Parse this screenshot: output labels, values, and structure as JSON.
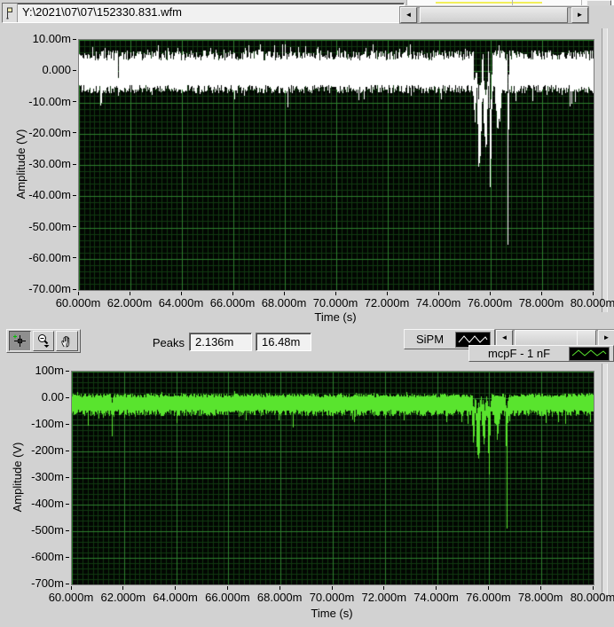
{
  "icons": {
    "left_arrow": "◄",
    "right_arrow": "►"
  },
  "path_bar": {
    "value": "Y:\\2021\\07\\07\\152330.831.wfm"
  },
  "toolbar": {
    "peaks_label": "Peaks",
    "peak_values": [
      "2.136m",
      "16.48m"
    ]
  },
  "legends": {
    "sipm": {
      "label": "SiPM",
      "color": "#ffffff"
    },
    "mcp": {
      "label": "mcpF - 1 nF",
      "color": "#59e42e"
    }
  },
  "clipped_top": {
    "line_color": "#f2ef5a"
  },
  "chart_data": [
    {
      "type": "line",
      "series_name": "SiPM",
      "color": "#ffffff",
      "bg": "#020602",
      "grid": {
        "major": "#2e7f2e",
        "minor": "#113a11"
      },
      "xlabel": "Time (s)",
      "ylabel": "Amplitude (V)",
      "x_range_ms": [
        60,
        80
      ],
      "y_range_mv": [
        -70,
        10
      ],
      "x_major_ms": 2,
      "x_minor_ms": 0.2,
      "y_major_mv": 10,
      "y_minor_mv": 2,
      "x_ticks": [
        "60.000m",
        "62.000m",
        "64.000m",
        "66.000m",
        "68.000m",
        "70.000m",
        "72.000m",
        "74.000m",
        "76.000m",
        "78.000m",
        "80.000m"
      ],
      "y_ticks": [
        "10.00m",
        "0.000",
        "-10.00m",
        "-20.00m",
        "-30.00m",
        "-40.00m",
        "-50.00m",
        "-60.00m",
        "-70.00m"
      ],
      "noise": {
        "band_high": 6.5,
        "jitter_high": 3.2,
        "band_low": -4.2,
        "jitter_low": 2.8,
        "up_prob": 0.18,
        "up_extra": 2.5,
        "spike_prob": 0.07,
        "spike_extra": 5
      },
      "events": [
        {
          "t": 61.55,
          "w": 0.05,
          "depth": -12.5
        },
        {
          "t": 75.4,
          "w": 0.1,
          "depth": -20
        },
        {
          "t": 75.58,
          "w": 0.16,
          "depth": -42
        },
        {
          "t": 75.8,
          "w": 0.14,
          "depth": -35
        },
        {
          "t": 76.0,
          "w": 0.1,
          "depth": -41
        },
        {
          "t": 76.3,
          "w": 0.26,
          "depth": -20,
          "partial": true
        },
        {
          "t": 76.68,
          "w": 0.05,
          "depth": -70
        }
      ],
      "seed": 3
    },
    {
      "type": "line",
      "series_name": "mcpF - 1 nF",
      "color": "#59e42e",
      "bg": "#020602",
      "grid": {
        "major": "#2e7f2e",
        "minor": "#113a11"
      },
      "xlabel": "Time (s)",
      "ylabel": "Amplitude (V)",
      "x_range_ms": [
        60,
        80
      ],
      "y_range_mv": [
        -700,
        100
      ],
      "x_major_ms": 2,
      "x_minor_ms": 0.2,
      "y_major_mv": 100,
      "y_minor_mv": 20,
      "x_ticks": [
        "60.000m",
        "62.000m",
        "64.000m",
        "66.000m",
        "68.000m",
        "70.000m",
        "72.000m",
        "74.000m",
        "76.000m",
        "78.000m",
        "80.000m"
      ],
      "y_ticks": [
        "100m",
        "0.00",
        "-100m",
        "-200m",
        "-300m",
        "-400m",
        "-500m",
        "-600m",
        "-700m"
      ],
      "noise": {
        "band_high": 16,
        "jitter_high": 14,
        "band_low": -42,
        "jitter_low": 25,
        "up_prob": 0.18,
        "up_extra": 8,
        "spike_prob": 0.05,
        "spike_extra": 45
      },
      "events": [
        {
          "t": 61.55,
          "w": 0.05,
          "depth": -150
        },
        {
          "t": 75.4,
          "w": 0.1,
          "depth": -180
        },
        {
          "t": 75.58,
          "w": 0.16,
          "depth": -300
        },
        {
          "t": 75.8,
          "w": 0.14,
          "depth": -260
        },
        {
          "t": 76.0,
          "w": 0.1,
          "depth": -300
        },
        {
          "t": 76.3,
          "w": 0.26,
          "depth": -160,
          "partial": true
        },
        {
          "t": 76.68,
          "w": 0.05,
          "depth": -655
        }
      ],
      "seed": 17
    }
  ]
}
